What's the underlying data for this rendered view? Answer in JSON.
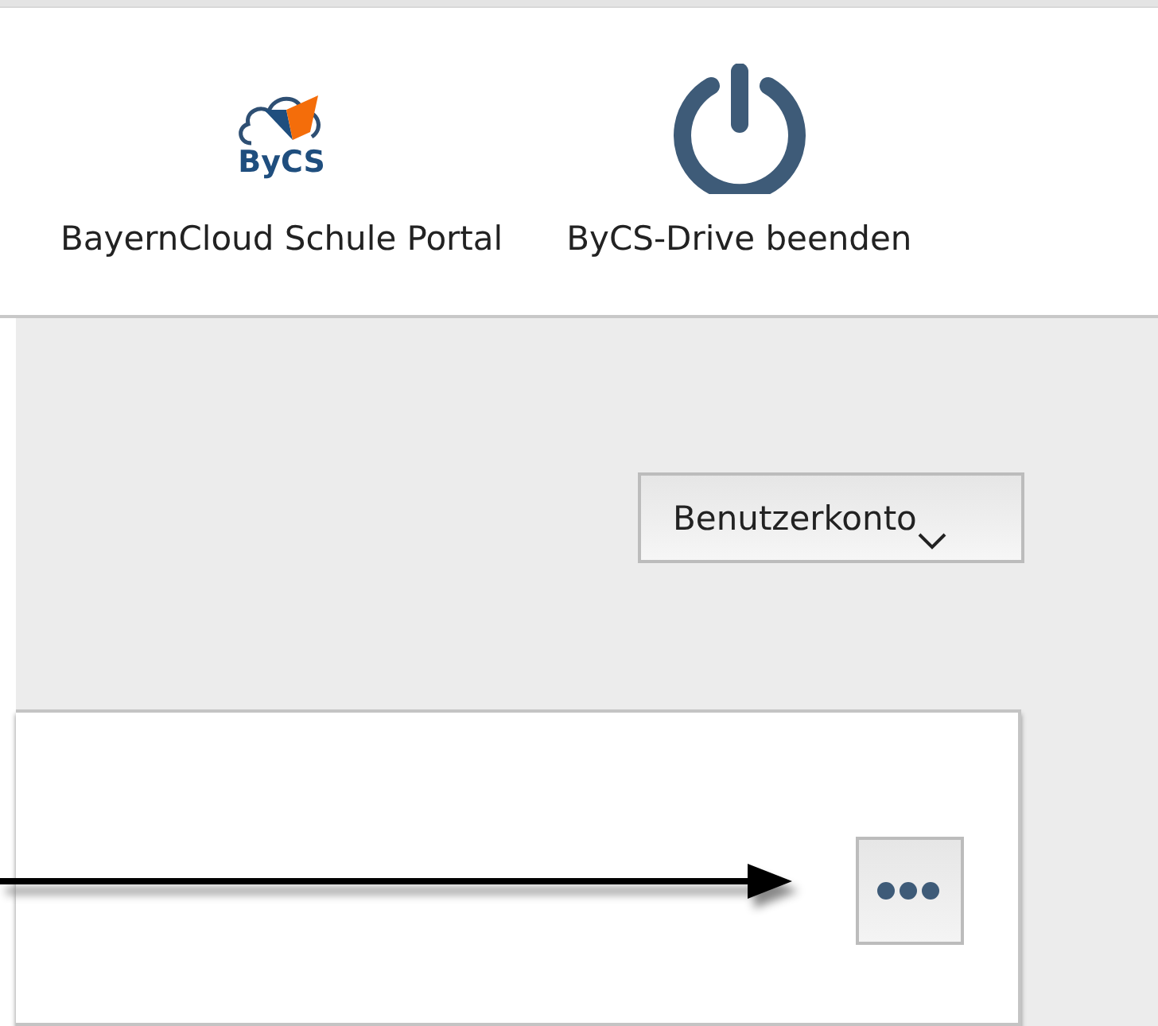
{
  "header": {
    "apps": [
      {
        "kind": "bycs",
        "logo_text": "ByCS",
        "label": "BayernCloud Schule Portal"
      },
      {
        "kind": "power",
        "label": "ByCS-Drive beenden"
      }
    ]
  },
  "account_menu": {
    "label": "Benutzerkonto"
  },
  "card": {
    "more_button": {
      "kind": "dots"
    }
  }
}
